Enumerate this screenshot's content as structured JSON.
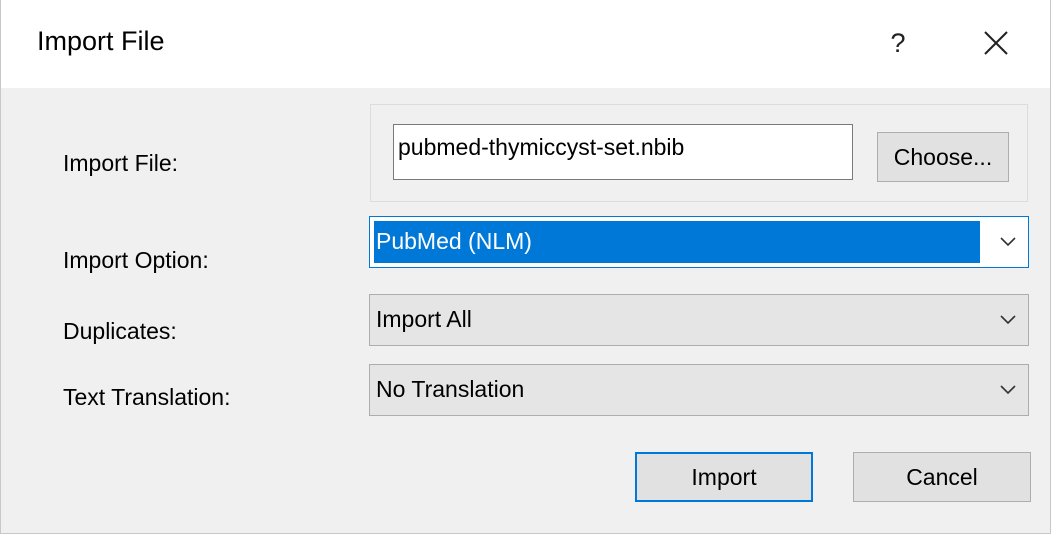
{
  "window": {
    "title": "Import File",
    "help_label": "?"
  },
  "form": {
    "import_file_label": "Import File:",
    "import_file_value": "pubmed-thymiccyst-set.nbib",
    "choose_label": "Choose...",
    "import_option_label": "Import Option:",
    "import_option_value": "PubMed (NLM)",
    "duplicates_label": "Duplicates:",
    "duplicates_value": "Import All",
    "text_translation_label": "Text Translation:",
    "text_translation_value": "No Translation"
  },
  "buttons": {
    "import_label": "Import",
    "cancel_label": "Cancel"
  },
  "colors": {
    "accent": "#0078d7",
    "dialog_bg": "#f0f0f0",
    "button_bg": "#e1e1e1"
  },
  "icons": {
    "help": "question-mark-icon",
    "close": "close-icon",
    "dropdown": "chevron-down-icon"
  }
}
